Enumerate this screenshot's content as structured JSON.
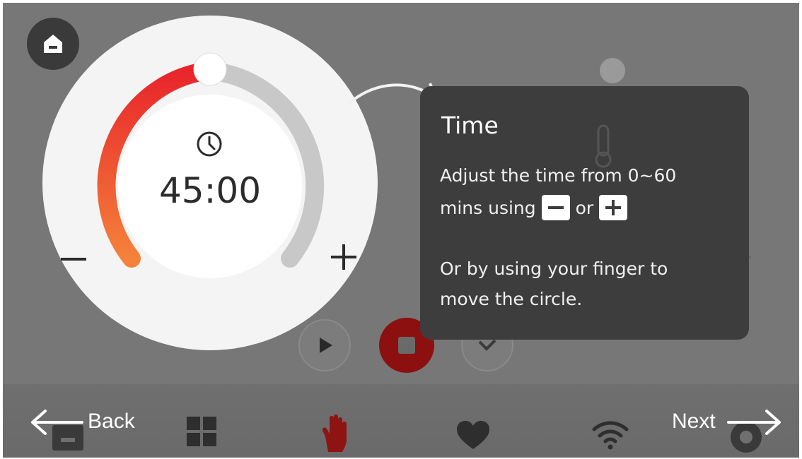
{
  "dial": {
    "time_display": "45:00",
    "level": 0.5
  },
  "tooltip": {
    "title": "Time",
    "line1": "Adjust the time from 0~60",
    "line2_pre": "mins using",
    "line2_mid": "or",
    "line3": "Or by using your finger to",
    "line4": "move the circle."
  },
  "nav": {
    "back_label": "Back",
    "next_label": "Next"
  },
  "colors": {
    "accent_red": "#e8252b",
    "accent_orange": "#f4823a",
    "tooltip_bg": "#3d3d3d",
    "stop_red": "#8c1010"
  },
  "icons": [
    "home-icon",
    "clock-icon",
    "minus-icon",
    "plus-icon",
    "play-icon",
    "stop-icon",
    "check-icon",
    "grid-icon",
    "hand-icon",
    "heart-icon",
    "wifi-icon",
    "arrow-left-icon",
    "arrow-right-icon",
    "thermometer-icon"
  ]
}
